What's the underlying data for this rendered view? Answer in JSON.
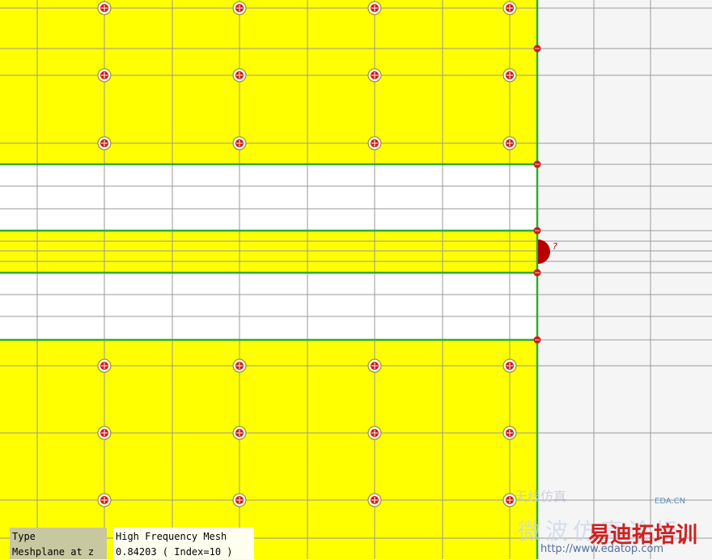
{
  "info_panel": {
    "type_label": "Type",
    "type_value": "High Frequency Mesh",
    "meshplane_label": "Meshplane at z",
    "meshplane_value": "0.84203 ( Index=10 )"
  },
  "port": {
    "label": "?"
  },
  "watermark": {
    "brand_top": "天线仿真",
    "brand_main": "微波仿真论坛",
    "brand_red": "易迪拓培训",
    "site_small": "EDA.CN",
    "url": "http://www.edatop.com"
  },
  "colors": {
    "background": "#f5f5f5",
    "metal": "#ffff00",
    "gap": "#ffffff",
    "edge": "#2eae2e",
    "grid": "#9a9a9a",
    "via": "#d01818"
  }
}
